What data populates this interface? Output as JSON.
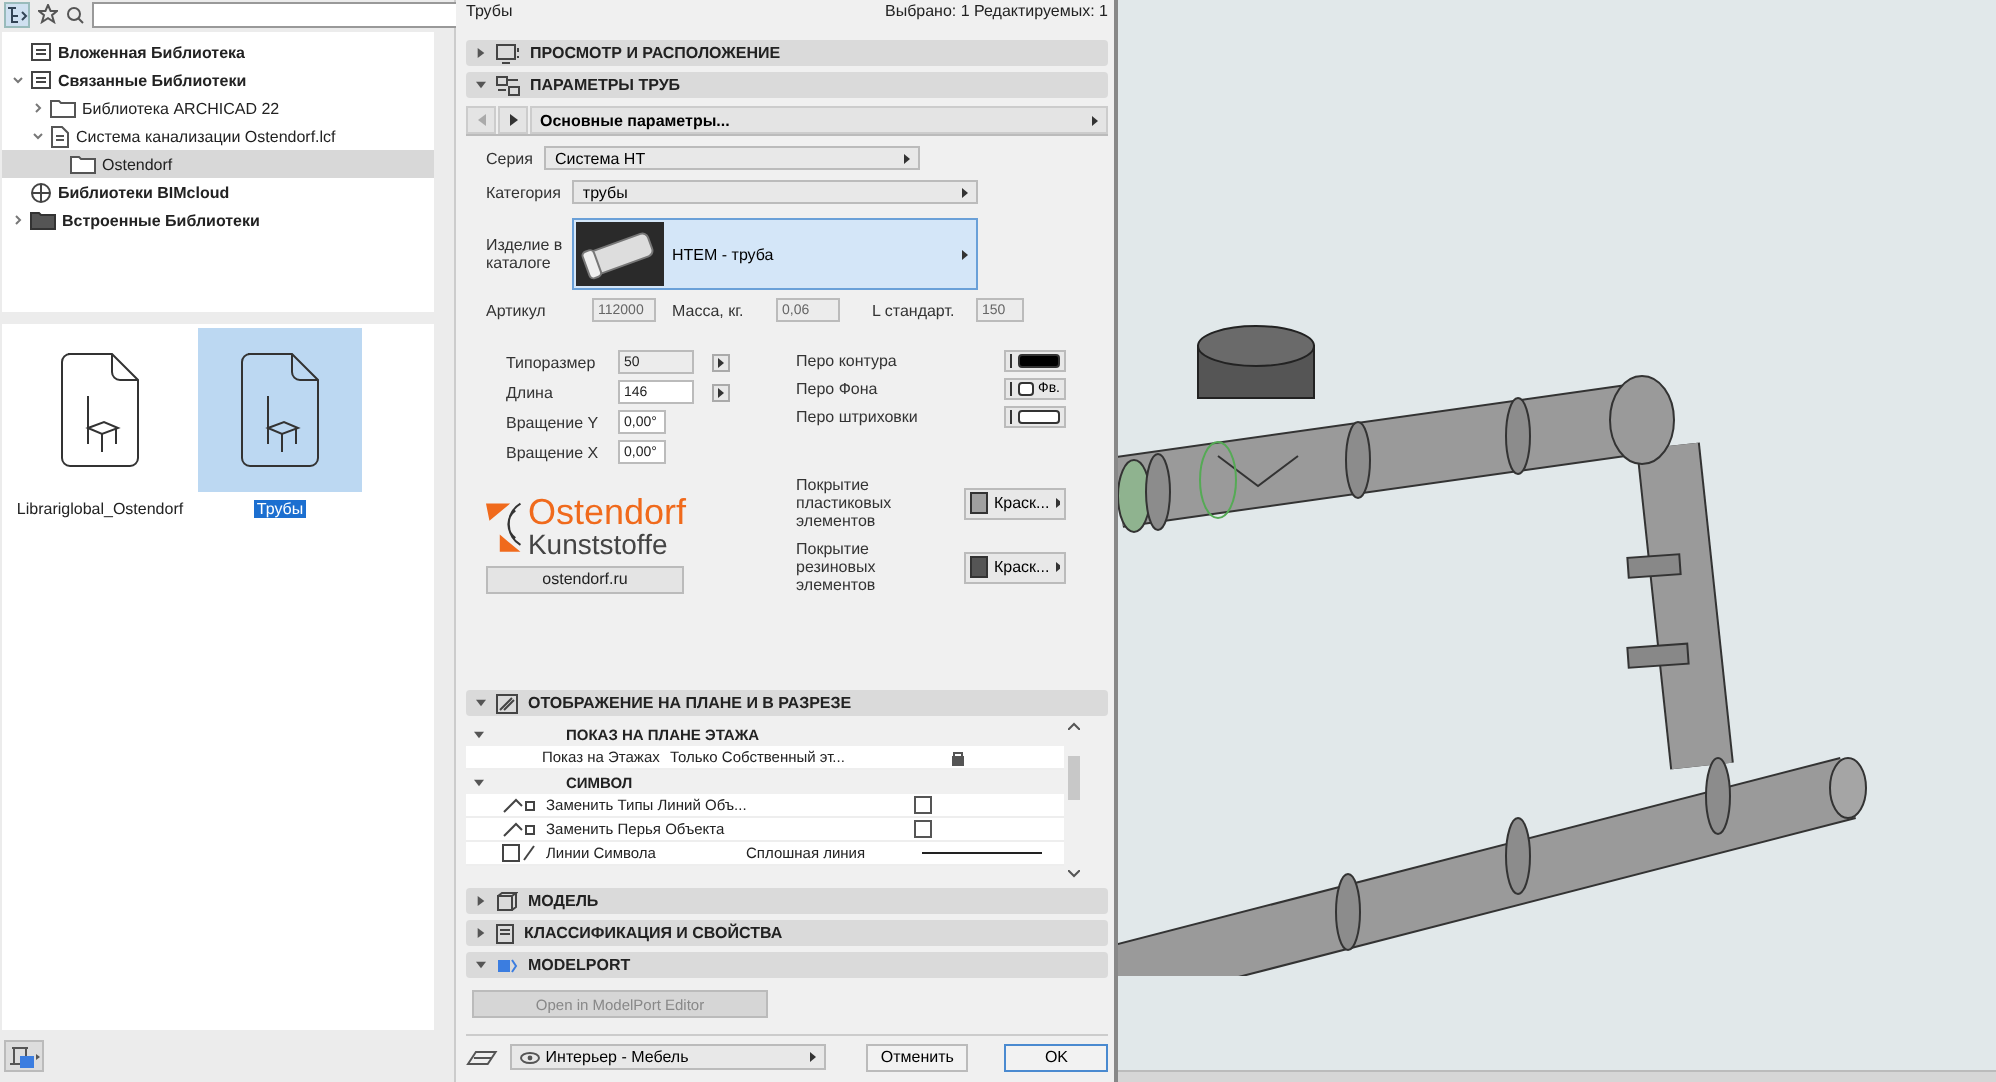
{
  "library": {
    "tree": [
      {
        "label": "Вложенная Библиотека",
        "selected": false
      },
      {
        "label": "Связанные Библиотеки",
        "expanded": true,
        "selected": false,
        "children": [
          {
            "label": "Библиотека ARCHICAD 22",
            "expanded": false,
            "selected": false
          },
          {
            "label": "Система канализации Ostendorf.lcf",
            "expanded": true,
            "selected": false,
            "children": [
              {
                "label": "Ostendorf",
                "selected": true
              }
            ]
          }
        ]
      },
      {
        "label": "Библиотеки BIMcloud",
        "selected": false
      },
      {
        "label": "Встроенные Библиотеки",
        "expanded": false,
        "selected": false
      }
    ],
    "thumbnails": [
      {
        "label": "Librariglobal_Ostendorf",
        "selected": false
      },
      {
        "label": "Трубы",
        "selected": true
      }
    ]
  },
  "dialog": {
    "title": "Трубы",
    "status": "Выбрано: 1 Редактируемых: 1",
    "sections_top": [
      {
        "title": "ПРОСМОТР И РАСПОЛОЖЕНИЕ",
        "expanded": false
      },
      {
        "title": "ПАРАМЕТРЫ ТРУБ",
        "expanded": true
      }
    ],
    "nav": "Основные параметры...",
    "series": {
      "label": "Серия",
      "value": "Система НТ"
    },
    "category": {
      "label": "Категория",
      "value": "трубы"
    },
    "product": {
      "label": "Изделие в каталоге",
      "value": "HTEM - труба"
    },
    "readonly": [
      {
        "label": "Артикул",
        "value": "112000"
      },
      {
        "label": "Масса, кг.",
        "value": "0,06"
      },
      {
        "label": "L стандарт.",
        "value": "150"
      }
    ],
    "sizes": [
      {
        "label": "Типоразмер",
        "value": "50",
        "kind": "stepper",
        "disabled": true
      },
      {
        "label": "Длина",
        "value": "146",
        "kind": "stepper",
        "disabled": false
      },
      {
        "label": "Вращение Y",
        "value": "0,00°",
        "kind": "plain",
        "disabled": false
      },
      {
        "label": "Вращение X",
        "value": "0,00°",
        "kind": "plain",
        "disabled": false
      }
    ],
    "pens": [
      {
        "label": "Перо контура",
        "color": "#000000"
      },
      {
        "label": "Перо Фона",
        "color": "#ffffff",
        "value": "Фв."
      },
      {
        "label": "Перо штриховки",
        "color": "#ffffff"
      }
    ],
    "logo": {
      "name": "Ostendorf",
      "subtitle": "Kunststoffe",
      "link": "ostendorf.ru"
    },
    "coatings": [
      {
        "label": "Покрытие пластиковых элементов",
        "value": "Краск...",
        "color": "#a0a0a0"
      },
      {
        "label": "Покрытие резиновых элементов",
        "value": "Краск...",
        "color": "#555555"
      }
    ],
    "display_section": {
      "title": "ОТОБРАЖЕНИЕ НА ПЛАНЕ И В РАЗРЕЗЕ",
      "expanded": true
    },
    "groups": [
      {
        "title": "ПОКАЗ НА ПЛАНЕ ЭТАЖА",
        "expanded": true,
        "rows": [
          {
            "label": "Показ на Этажах",
            "value": "Только Собственный эт...",
            "kind": "lock"
          }
        ]
      },
      {
        "title": "СИМВОЛ",
        "expanded": true,
        "rows": [
          {
            "label": "Заменить Типы Линий Объ...",
            "kind": "check",
            "checked": false
          },
          {
            "label": "Заменить Перья Объекта",
            "kind": "check",
            "checked": false
          },
          {
            "label": "Линии Символа",
            "value": "Сплошная линия",
            "kind": "line"
          }
        ]
      }
    ],
    "sections_bottom": [
      {
        "title": "МОДЕЛЬ",
        "expanded": false
      },
      {
        "title": "КЛАССИФИКАЦИЯ И СВОЙСТВА",
        "expanded": false
      },
      {
        "title": "MODELPORT",
        "expanded": true
      }
    ],
    "modelport_button": {
      "label": "Open in ModelPort Editor",
      "disabled": true
    },
    "footer": {
      "layer": "Интерьер - Мебель",
      "cancel": "Отменить",
      "ok": "OK"
    }
  }
}
